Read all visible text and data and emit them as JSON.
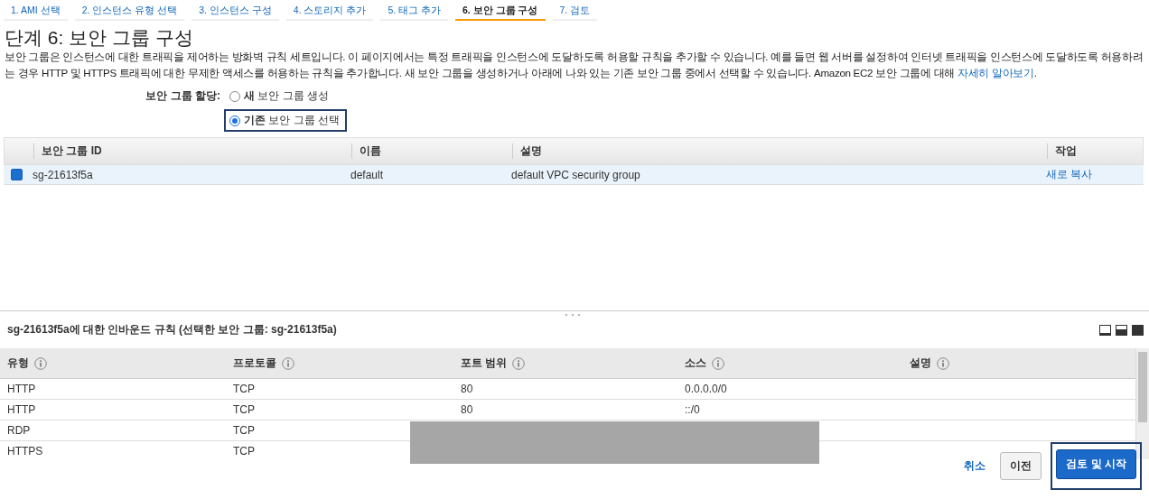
{
  "steps": [
    {
      "label": "1. AMI 선택",
      "selected": false
    },
    {
      "label": "2. 인스턴스 유형 선택",
      "selected": false
    },
    {
      "label": "3. 인스턴스 구성",
      "selected": false
    },
    {
      "label": "4. 스토리지 추가",
      "selected": false
    },
    {
      "label": "5. 태그 추가",
      "selected": false
    },
    {
      "label": "6. 보안 그룹 구성",
      "selected": true
    },
    {
      "label": "7. 검토",
      "selected": false
    }
  ],
  "title": "단계 6: 보안 그룹 구성",
  "description": {
    "text": "보안 그룹은 인스턴스에 대한 트래픽을 제어하는 방화벽 규칙 세트입니다. 이 페이지에서는 특정 트래픽을 인스턴스에 도달하도록 허용할 규칙을 추가할 수 있습니다. 예를 들면 웹 서버를 설정하여 인터넷 트래픽을 인스턴스에 도달하도록 허용하려는 경우 HTTP 및 HTTPS 트래픽에 대한 무제한 액세스를 허용하는 규칙을 추가합니다. 새 보안 그룹을 생성하거나 아래에 나와 있는 기존 보안 그룹 중에서 선택할 수 있습니다. Amazon EC2 보안 그룹에 대해",
    "link": "자세히 알아보기",
    "end": "."
  },
  "assign": {
    "label": "보안 그룹 할당:",
    "options": [
      {
        "bold": "새",
        "rest": "보안 그룹 생성",
        "selected": false
      },
      {
        "bold": "기존",
        "rest": "보안 그룹 선택",
        "selected": true
      }
    ]
  },
  "groups_table": {
    "columns": [
      "보안 그룹 ID",
      "이름",
      "설명",
      "작업"
    ],
    "rows": [
      {
        "id": "sg-21613f5a",
        "name": "default",
        "description": "default VPC security group",
        "action": "새로 복사",
        "selected": true
      }
    ]
  },
  "rules_panel": {
    "title": "sg-21613f5a에 대한 인바운드 규칙 (선택한 보안 그룹: sg-21613f5a)",
    "columns": [
      "유형",
      "프로토콜",
      "포트 범위",
      "소스",
      "설명"
    ],
    "rows": [
      [
        "HTTP",
        "TCP",
        "80",
        "0.0.0.0/0"
      ],
      [
        "HTTP",
        "TCP",
        "80",
        "::/0"
      ],
      [
        "RDP",
        "TCP",
        "",
        ""
      ],
      [
        "HTTPS",
        "TCP",
        "",
        ""
      ]
    ]
  },
  "footer": {
    "cancel": "취소",
    "previous": "이전",
    "launch": "검토 및 시작"
  }
}
